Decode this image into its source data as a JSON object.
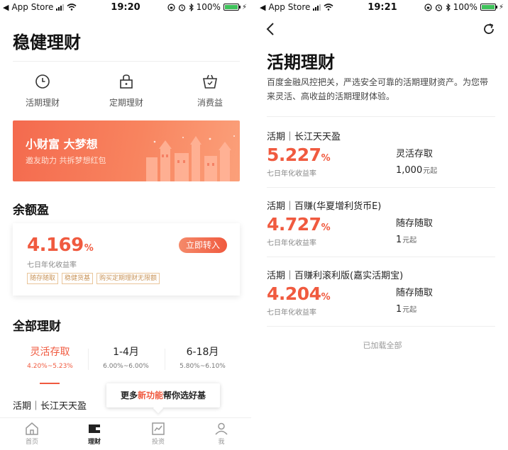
{
  "status_left": {
    "carrier": "App Store",
    "time": "19:20",
    "battery": "100%"
  },
  "status_right": {
    "carrier": "App Store",
    "time": "19:21",
    "battery": "100%"
  },
  "left": {
    "title": "稳健理财",
    "quick_links": [
      {
        "label": "活期理财",
        "icon": "clock-icon"
      },
      {
        "label": "定期理财",
        "icon": "lock-icon"
      },
      {
        "label": "消费益",
        "icon": "basket-icon"
      }
    ],
    "banner": {
      "title": "小财富 大梦想",
      "subtitle": "邀友助力 共拆梦想红包"
    },
    "yuebao": {
      "section_title": "余额盈",
      "rate_value": "4.169",
      "rate_unit": "%",
      "rate_label": "七日年化收益率",
      "cta": "立即转入",
      "tags": [
        "随存随取",
        "稳健货基",
        "购买定期理财无限额"
      ]
    },
    "all": {
      "section_title": "全部理财",
      "tabs": [
        {
          "label": "灵活存取",
          "range": "4.20%~5.23%"
        },
        {
          "label": "1-4月",
          "range": "6.00%~6.00%"
        },
        {
          "label": "6-18月",
          "range": "5.80%~6.10%"
        }
      ],
      "peek_product": "活期｜长江天天盈",
      "tooltip_prefix": "更多",
      "tooltip_highlight": "新功能",
      "tooltip_suffix": "帮你选好基"
    },
    "tabbar": [
      {
        "label": "首页",
        "icon": "home-icon"
      },
      {
        "label": "理财",
        "icon": "wallet-icon"
      },
      {
        "label": "投资",
        "icon": "chart-icon"
      },
      {
        "label": "我",
        "icon": "person-icon"
      }
    ]
  },
  "right": {
    "title": "活期理财",
    "description": "百度金融风控把关，严选安全可靠的活期理财资产。为您带来灵活、高收益的活期理财体验。",
    "funds": [
      {
        "name": "活期｜长江天天盈",
        "rate": "5.227",
        "unit": "%",
        "rate_label": "七日年化收益率",
        "term": "灵活存取",
        "min": "1,000",
        "min_unit": "元起"
      },
      {
        "name": "活期｜百赚(华夏增利货币E)",
        "rate": "4.727",
        "unit": "%",
        "rate_label": "七日年化收益率",
        "term": "随存随取",
        "min": "1",
        "min_unit": "元起"
      },
      {
        "name": "活期｜百赚利滚利版(嘉实活期宝)",
        "rate": "4.204",
        "unit": "%",
        "rate_label": "七日年化收益率",
        "term": "随存随取",
        "min": "1",
        "min_unit": "元起"
      }
    ],
    "loaded_all": "已加载全部"
  },
  "colors": {
    "accent": "#f05a3f",
    "tag_border": "#e9c59a",
    "tag_text": "#c9955a"
  }
}
